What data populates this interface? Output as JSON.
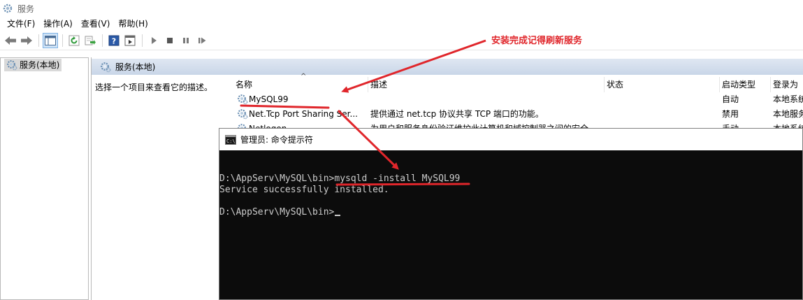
{
  "window": {
    "title": "服务",
    "icon": "gear-icon"
  },
  "menu": {
    "items": [
      "文件(F)",
      "操作(A)",
      "查看(V)",
      "帮助(H)"
    ]
  },
  "toolbar": {
    "buttons": [
      "back-arrow-icon",
      "forward-arrow-icon",
      "console-tree-icon",
      "refresh-icon",
      "export-icon",
      "help-icon",
      "properties-icon",
      "play-icon",
      "stop-icon",
      "pause-icon",
      "restart-icon"
    ]
  },
  "tree": {
    "root_label": "服务(本地)"
  },
  "pane": {
    "header_label": "服务(本地)",
    "description_prompt": "选择一个项目来查看它的描述。"
  },
  "list": {
    "columns": {
      "name": "名称",
      "description": "描述",
      "status": "状态",
      "startup_type": "启动类型",
      "logon_as": "登录为"
    },
    "rows": [
      {
        "name": "MySQL99",
        "description": "",
        "status": "",
        "startup_type": "自动",
        "logon_as": "本地系统"
      },
      {
        "name": "Net.Tcp Port Sharing Ser...",
        "description": "提供通过 net.tcp 协议共享 TCP 端口的功能。",
        "status": "",
        "startup_type": "禁用",
        "logon_as": "本地服务"
      },
      {
        "name": "Netlogon",
        "description": "为用户和服务身份验证维护此计算机和域控制器之间的安全...",
        "status": "",
        "startup_type": "手动",
        "logon_as": "本地系统"
      }
    ]
  },
  "cmd": {
    "title": "管理员: 命令提示符",
    "line1_prompt": "D:\\AppServ\\MySQL\\bin>",
    "line1_command": "mysqld -install MySQL99",
    "line2": "Service successfully installed.",
    "line3_prompt": "D:\\AppServ\\MySQL\\bin>"
  },
  "annotation": {
    "note": "安装完成记得刷新服务",
    "color": "#e0262b"
  }
}
